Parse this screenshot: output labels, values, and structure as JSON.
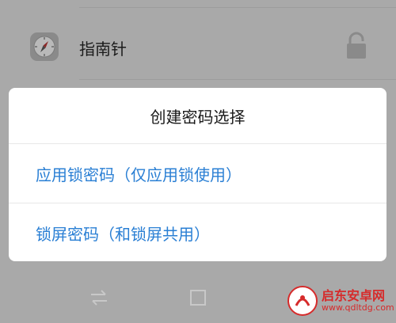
{
  "app_list": {
    "item": {
      "name": "指南针",
      "icon": "compass-icon",
      "lock_icon": "lock-open-icon"
    }
  },
  "dialog": {
    "title": "创建密码选择",
    "options": [
      {
        "label": "应用锁密码（仅应用锁使用）"
      },
      {
        "label": "锁屏密码（和锁屏共用）"
      }
    ]
  },
  "nav_bar": {
    "icons": [
      "switch-arrows-icon",
      "recent-apps-square-icon",
      "back-triangle-icon"
    ]
  },
  "watermark": {
    "name": "启东安卓网",
    "url": "www.qdltdg.com"
  },
  "colors": {
    "accent": "#2a7fd4",
    "scrim": "#a9a9a9",
    "dialog_bg": "#ffffff",
    "watermark": "#d62b2b"
  }
}
